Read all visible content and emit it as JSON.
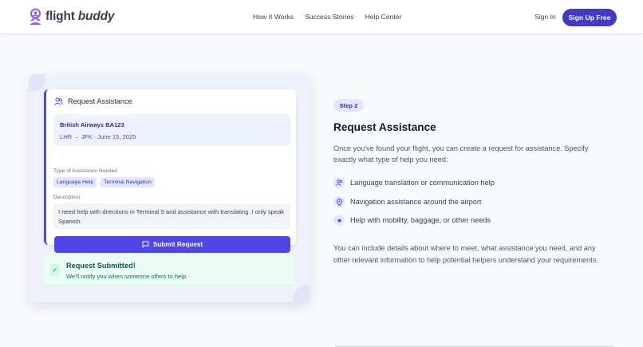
{
  "brand": {
    "name_main": "flight ",
    "name_italic": "buddy",
    "accent": "#4338ca"
  },
  "nav": {
    "links": [
      "How It Works",
      "Success Stories",
      "Help Center"
    ],
    "sign_in": "Sign In",
    "sign_up": "Sign Up Free"
  },
  "card": {
    "heading": "Request Assistance",
    "heading_icon": "users-icon",
    "flight_name": "British Airways BA123",
    "flight_route": "LHR → JFK · June 15, 2025",
    "assistance_label": "Type of Assistance Needed",
    "tags": [
      "Language Help",
      "Terminal Navigation"
    ],
    "description_label": "Description",
    "description": "I need help with directions in Terminal 5 and assistance with translating. I only speak Spanish.",
    "submit_label": "Submit Request",
    "submit_icon": "message-icon"
  },
  "success": {
    "title": "Request Submitted!",
    "subtitle": "We'll notify you when someone offers to help",
    "icon": "check-icon"
  },
  "info": {
    "step": "Step 2",
    "title": "Request Assistance",
    "intro": "Once you've found your flight, you can create a request for assistance. Specify exactly what type of help you need:",
    "features": [
      {
        "text": "Language translation or communication help",
        "icon": "users-icon"
      },
      {
        "text": "Navigation assistance around the airport",
        "icon": "map-pin-icon"
      },
      {
        "text": "Help with mobility, baggage, or other needs",
        "icon": "dot-icon"
      }
    ],
    "outro": "You can include details about where to meet, what assistance you need, and any other relevant information to help potential helpers understand your requirements."
  }
}
